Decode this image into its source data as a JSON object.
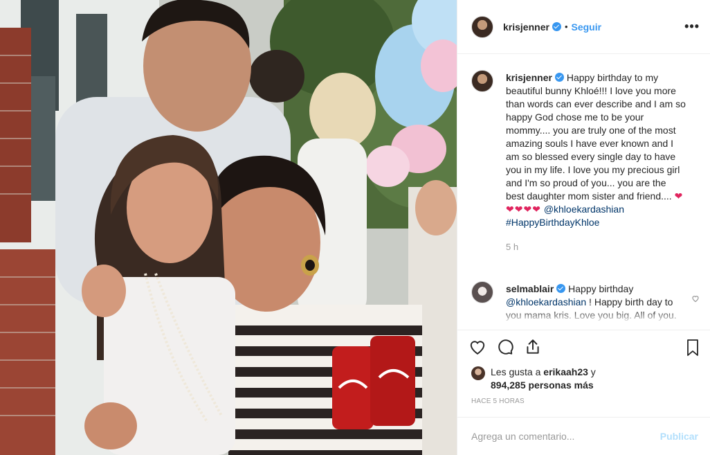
{
  "header": {
    "username": "krisjenner",
    "follow_label": "Seguir",
    "more_label": "•••"
  },
  "caption": {
    "username": "krisjenner",
    "text": "Happy birthday to my beautiful bunny Khloé!!! I love you more than words can ever describe and I am so happy God chose me to be your mommy.... you are truly one of the most amazing souls I have ever known and I am so blessed every single day to have you in my life. I love you my precious girl and I'm so proud of you... you are the best daughter mom sister and friend.... ",
    "hearts": "❤❤❤❤❤",
    "mention": "@khloekardashian",
    "hashtag": "#HappyBirthdayKhloe",
    "time": "5 h"
  },
  "comment": {
    "username": "selmablair",
    "text_1": "Happy birthday",
    "mention": "@khloekardashian",
    "text_2": " ! Happy birth day to you mama kris. Love you big. All of you. Blessings ",
    "hearts": "❤"
  },
  "likes": {
    "prefix": "Les gusta a ",
    "user": "erikaah23",
    "mid": " y",
    "count": "894,285 personas más"
  },
  "timestamp": "HACE 5 HORAS",
  "add_comment": {
    "placeholder": "Agrega un comentario...",
    "publish_label": "Publicar"
  },
  "colors": {
    "link": "#003569",
    "follow": "#3897f0",
    "verified": "#3897f0",
    "publish_disabled": "#b2dffc"
  }
}
